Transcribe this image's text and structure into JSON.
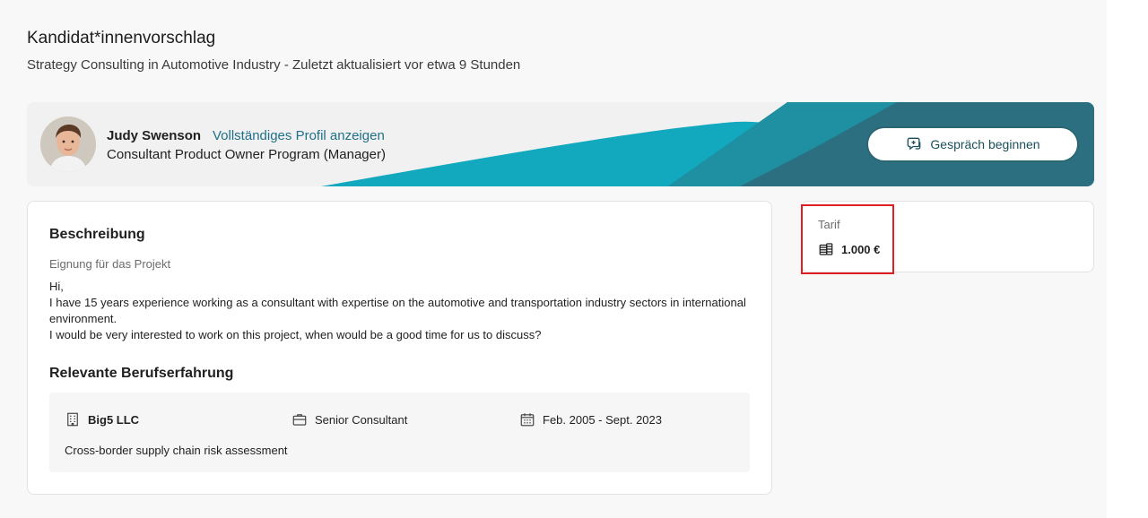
{
  "page": {
    "title": "Kandidat*innenvorschlag",
    "subtitle": "Strategy Consulting in Automotive Industry - Zuletzt aktualisiert vor etwa 9 Stunden"
  },
  "candidate": {
    "name": "Judy Swenson",
    "profile_link": "Vollständiges Profil anzeigen",
    "role": "Consultant Product Owner Program (Manager)",
    "start_chat_label": "Gespräch beginnen"
  },
  "description": {
    "heading": "Beschreibung",
    "suitability_label": "Eignung für das Projekt",
    "lines": [
      "Hi,",
      "I have 15 years experience working as a consultant with expertise on the automotive and transportation industry sectors in international environment.",
      "I would be very interested to work on this project, when would be a good time for us to discuss?"
    ]
  },
  "experience": {
    "heading": "Relevante Berufserfahrung",
    "items": [
      {
        "company": "Big5 LLC",
        "role": "Senior Consultant",
        "period": "Feb. 2005 - Sept. 2023",
        "description": "Cross-border supply chain risk assessment"
      }
    ]
  },
  "tarif": {
    "label": "Tarif",
    "value": "1.000 €"
  },
  "colors": {
    "accent": "#1f7088",
    "banner_light": "#12a8bd",
    "banner_dark": "#2b6f80",
    "highlight": "#e02020"
  },
  "icons": {
    "chat": "chat-plus-icon",
    "company": "building-icon",
    "role": "briefcase-icon",
    "period": "calendar-icon",
    "tarif": "coins-icon"
  }
}
